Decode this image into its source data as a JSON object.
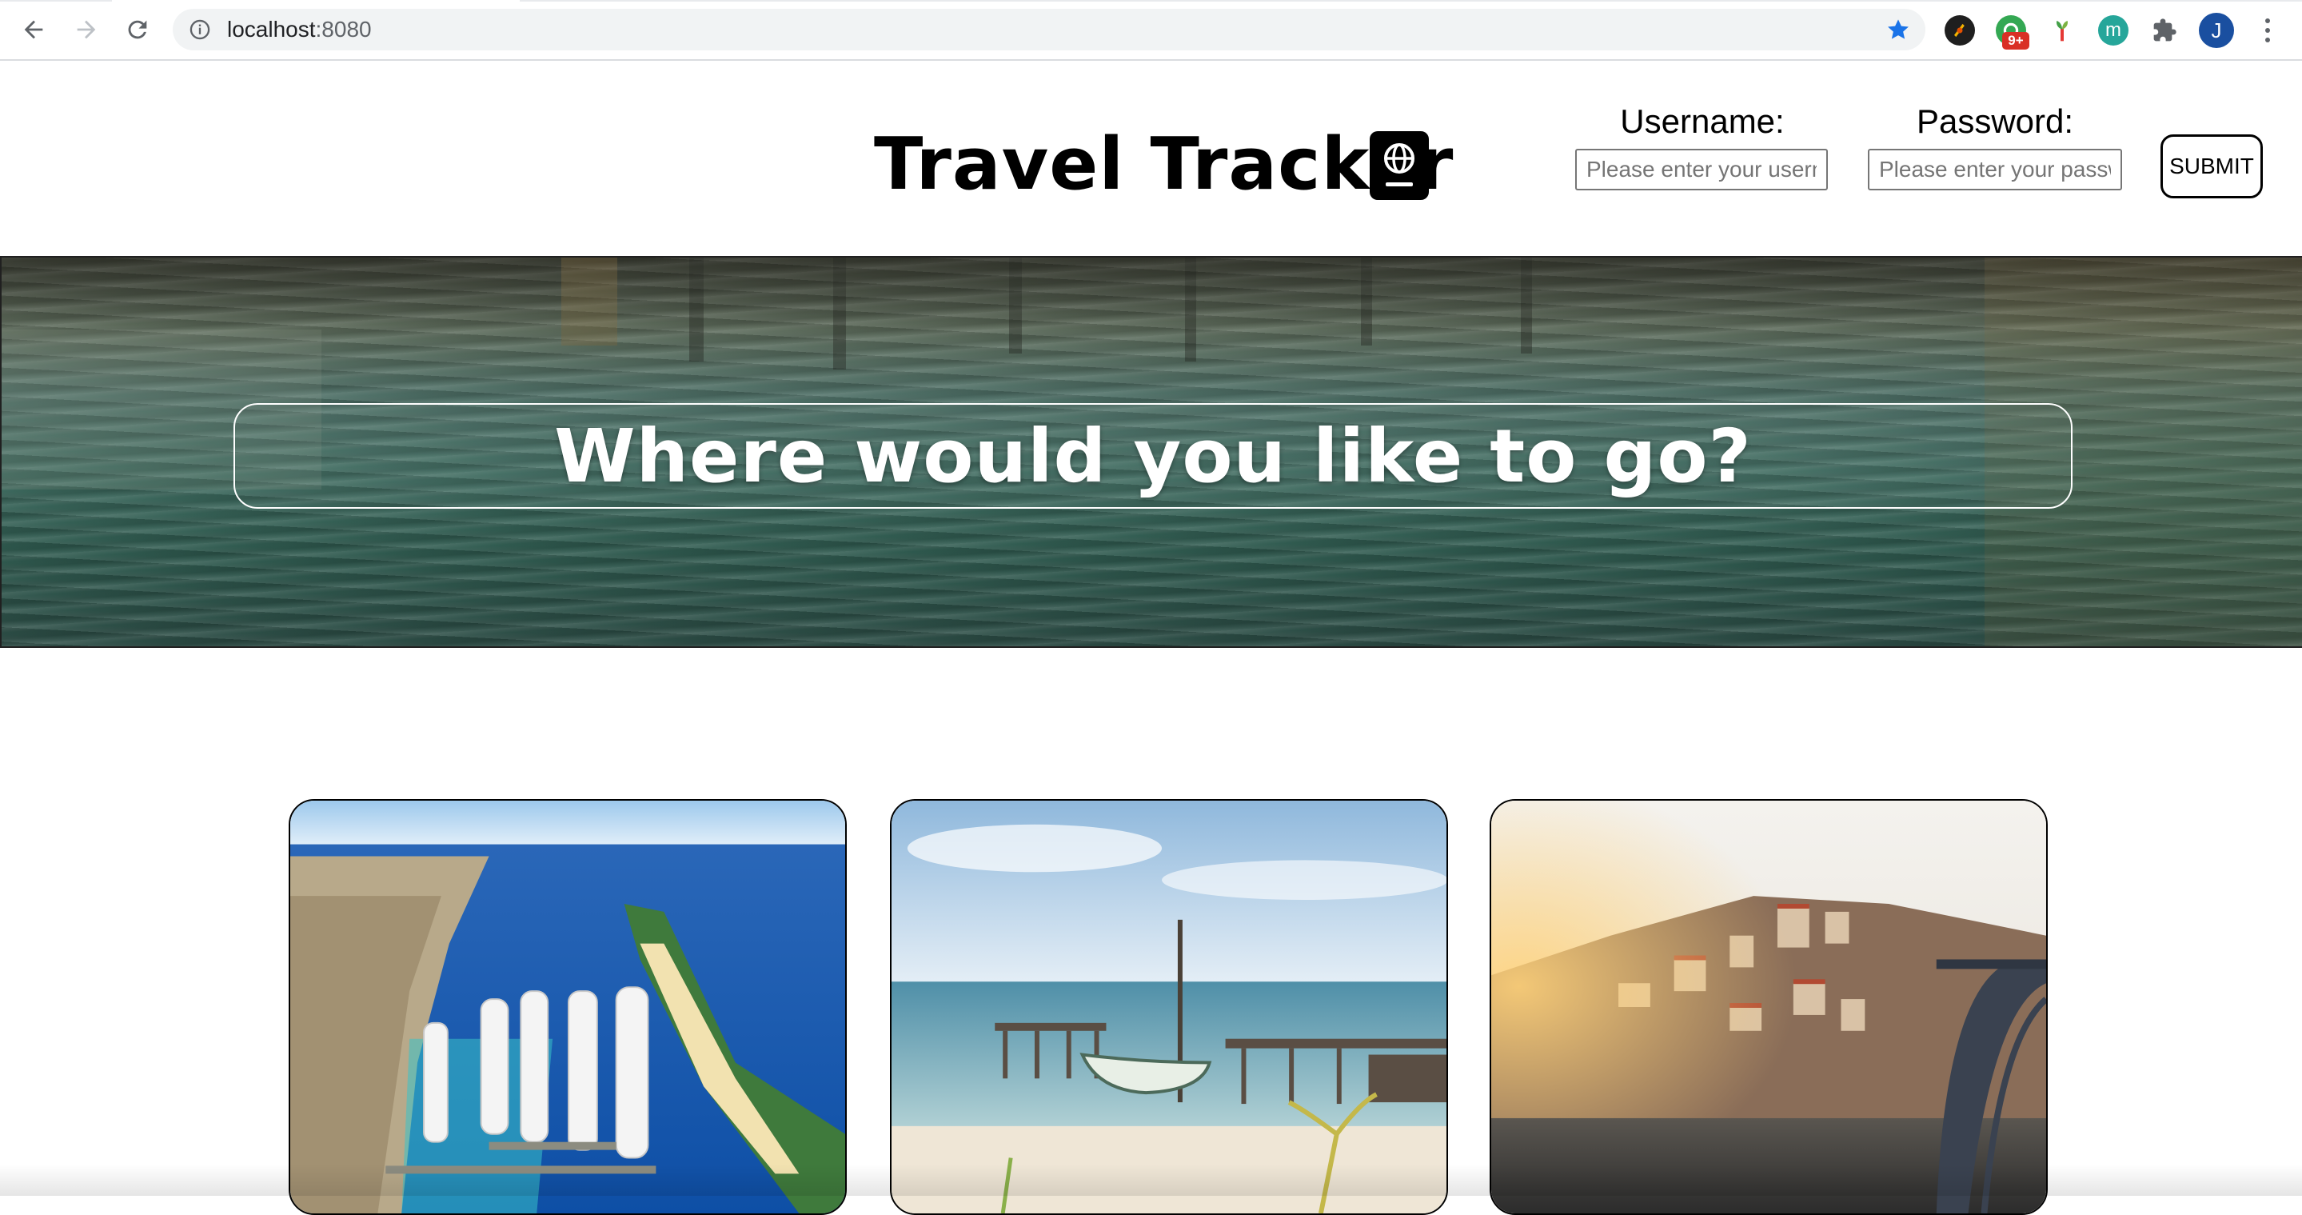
{
  "browser": {
    "url_host": "localhost",
    "url_port": ":8080",
    "extension_badge": "9+",
    "profile_initial": "J",
    "icons": [
      "back-arrow-icon",
      "forward-arrow-icon",
      "reload-icon",
      "site-info-icon",
      "bookmark-star-icon",
      "extension-puzzle-icon",
      "more-menu-icon"
    ],
    "accent_color": "#1a73e8"
  },
  "header": {
    "title": "Travel Tracker",
    "title_icon": "passport-icon",
    "username_label": "Username:",
    "username_placeholder": "Please enter your username",
    "password_label": "Password:",
    "password_placeholder": "Please enter your password",
    "submit_label": "SUBMIT"
  },
  "hero": {
    "heading": "Where would you like to go?"
  },
  "destinations": [
    {
      "image": "cruise-port-aerial"
    },
    {
      "image": "beach-pier-boat"
    },
    {
      "image": "hillside-city-bridge"
    }
  ]
}
